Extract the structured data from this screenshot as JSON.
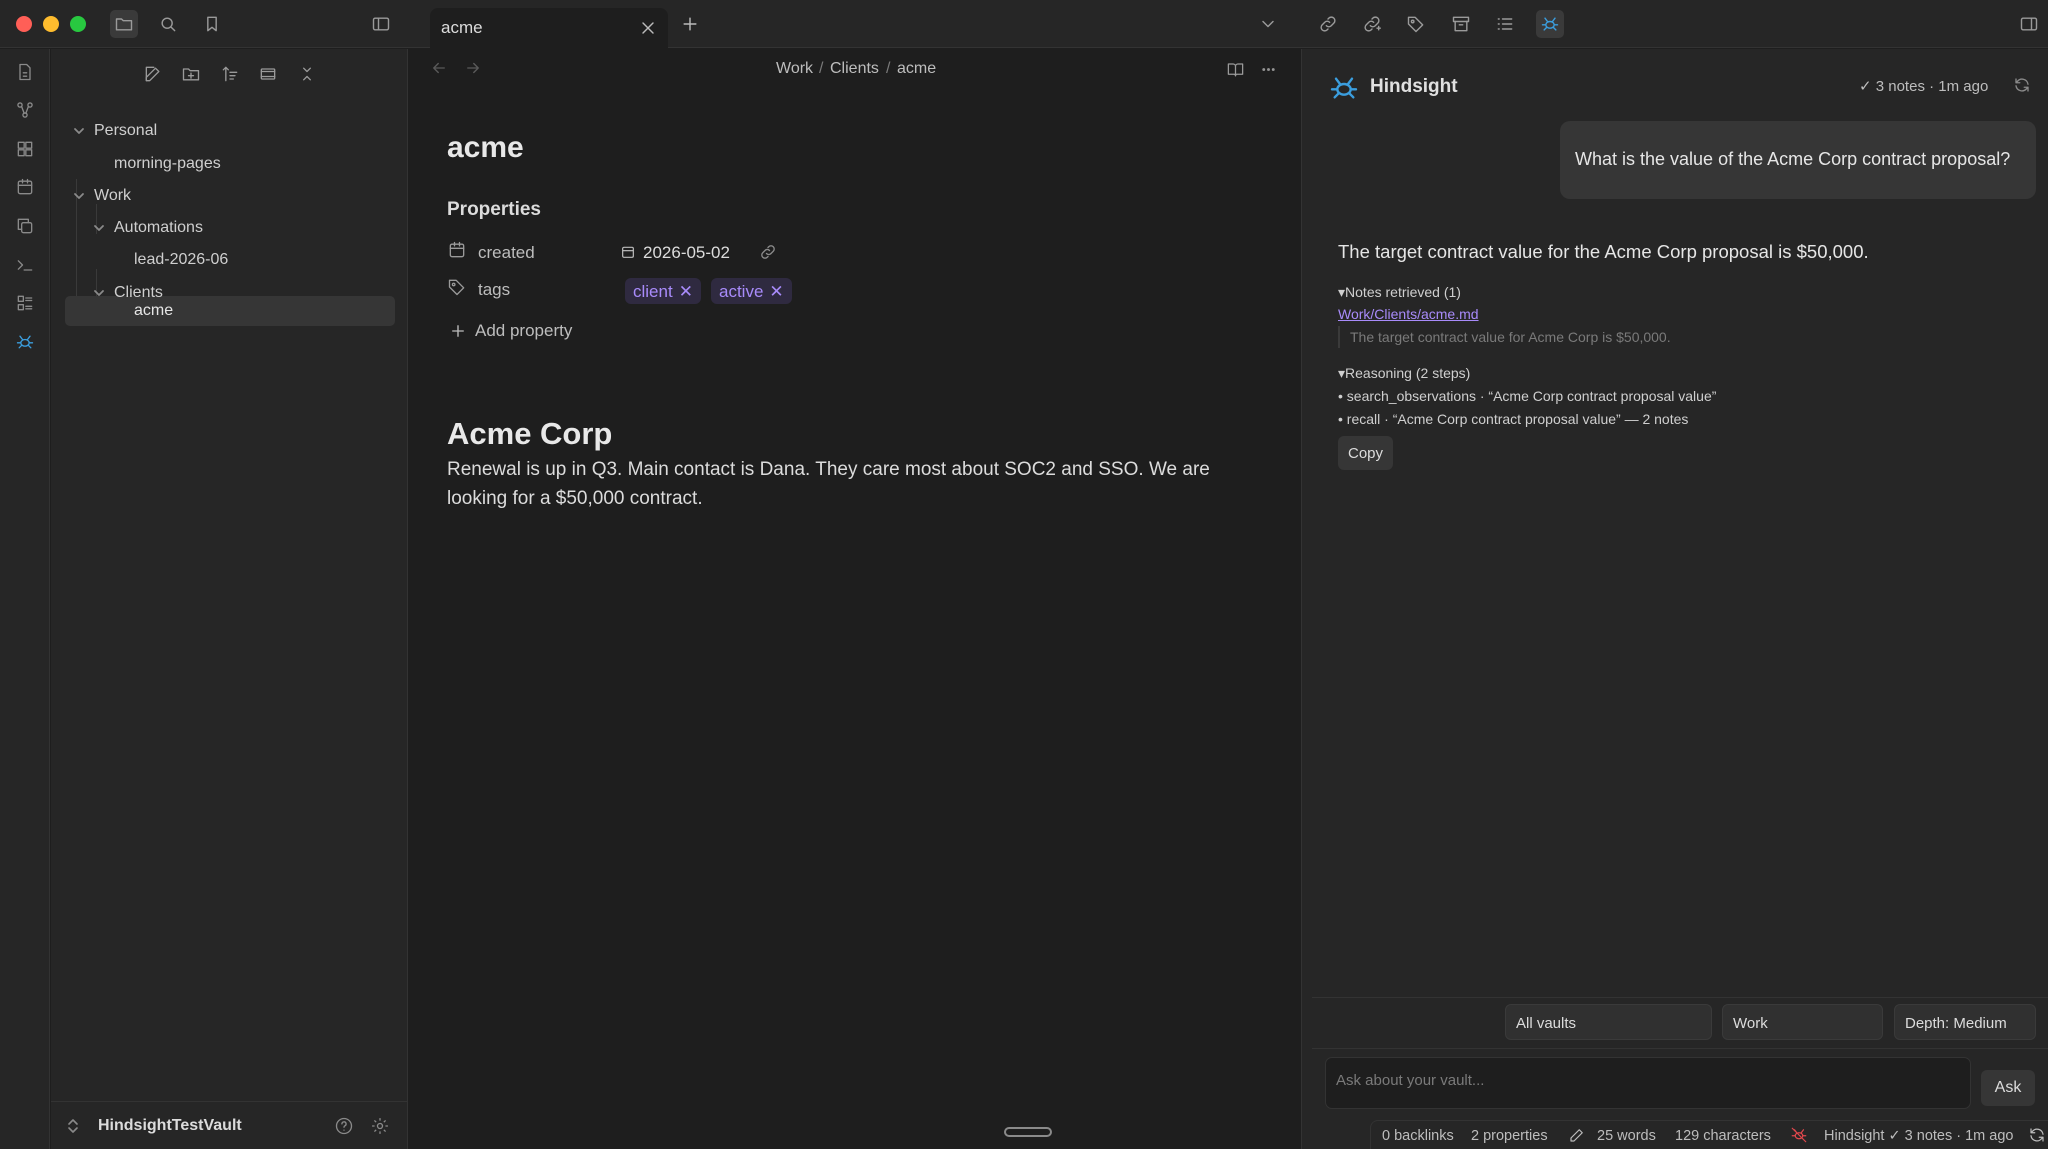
{
  "window": {
    "traffic_colors": [
      "#ff5f57",
      "#febc2e",
      "#28c840"
    ]
  },
  "tabs": [
    {
      "title": "acme"
    }
  ],
  "sidebar": {
    "tree": [
      {
        "label": "Personal",
        "type": "folder"
      },
      {
        "label": "morning-pages",
        "type": "file"
      },
      {
        "label": "Work",
        "type": "folder"
      },
      {
        "label": "Automations",
        "type": "folder"
      },
      {
        "label": "lead-2026-06",
        "type": "file"
      },
      {
        "label": "Clients",
        "type": "folder"
      },
      {
        "label": "acme",
        "type": "file",
        "selected": true
      }
    ],
    "vault_name": "HindsightTestVault"
  },
  "editor": {
    "breadcrumb": [
      "Work",
      "Clients",
      "acme"
    ],
    "title": "acme",
    "properties_heading": "Properties",
    "properties": {
      "created": {
        "key": "created",
        "value": "2026-05-02"
      },
      "tags": {
        "key": "tags",
        "values": [
          "client",
          "active"
        ]
      }
    },
    "add_property": "Add property",
    "heading": "Acme Corp",
    "paragraph": "Renewal is up in Q3. Main contact is Dana. They care most about SOC2 and SSO. We are looking for a $50,000 contract."
  },
  "hindsight": {
    "title": "Hindsight",
    "status": "✓ 3 notes · 1m ago",
    "question": "What is the value of the Acme Corp contract proposal?",
    "answer": "The target contract value for the Acme Corp proposal is $50,000.",
    "notes_retrieved_label": "▾Notes retrieved (1)",
    "note_link": "Work/Clients/acme.md",
    "note_excerpt": "The target contract value for Acme Corp is $50,000.",
    "reasoning_label": "▾Reasoning (2 steps)",
    "reasoning_steps": [
      "• search_observations · “Acme Corp contract proposal value”",
      "• recall · “Acme Corp contract proposal value” — 2 notes"
    ],
    "copy_label": "Copy",
    "scope_options": {
      "vaults": "All vaults",
      "folder": "Work",
      "depth": "Depth: Medium"
    },
    "ask_placeholder": "Ask about your vault...",
    "ask_label": "Ask",
    "accent": "#3b9ede"
  },
  "statusbar": {
    "backlinks": "0 backlinks",
    "properties": "2 properties",
    "words": "25 words",
    "characters": "129 characters",
    "hindsight": "Hindsight ✓ 3 notes · 1m ago"
  },
  "colors": {
    "tag_text": "#a88bfa",
    "tag_bg": "#2f2a40",
    "error_icon": "#e0484d"
  }
}
